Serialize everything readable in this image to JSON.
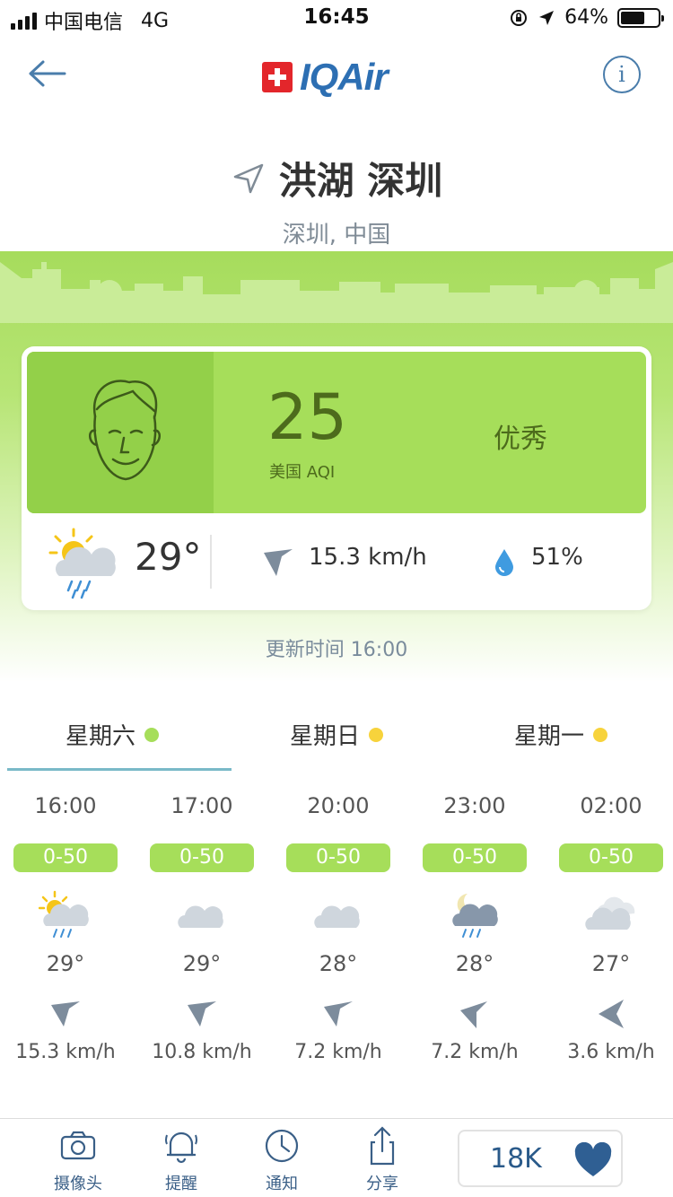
{
  "status_bar": {
    "carrier": "中国电信",
    "network": "4G",
    "time": "16:45",
    "battery": "64%",
    "battery_level": 0.64
  },
  "header": {
    "brand": "IQAir",
    "info_label": "i"
  },
  "location": {
    "name": "洪湖 深圳",
    "region": "深圳, 中国"
  },
  "aqi": {
    "value": "25",
    "label": "美国 AQI",
    "level": "优秀",
    "color": "#a6de5a"
  },
  "current_weather": {
    "temperature": "29°",
    "wind_speed": "15.3 km/h",
    "humidity": "51%",
    "icon": "sun-cloud-rain-icon"
  },
  "updated": "更新时间 16:00",
  "days": [
    {
      "label": "星期六",
      "dot_color": "#a6de5a",
      "active": true
    },
    {
      "label": "星期日",
      "dot_color": "#f7d33c",
      "active": false
    },
    {
      "label": "星期一",
      "dot_color": "#f7d33c",
      "active": false
    }
  ],
  "hourly": [
    {
      "time": "16:00",
      "aqi_range": "0-50",
      "icon": "sun-cloud-rain-icon",
      "temp": "29°",
      "wind": "15.3 km/h"
    },
    {
      "time": "17:00",
      "aqi_range": "0-50",
      "icon": "cloud-icon",
      "temp": "29°",
      "wind": "10.8 km/h"
    },
    {
      "time": "20:00",
      "aqi_range": "0-50",
      "icon": "cloud-icon",
      "temp": "28°",
      "wind": "7.2 km/h"
    },
    {
      "time": "23:00",
      "aqi_range": "0-50",
      "icon": "moon-cloud-rain-icon",
      "temp": "28°",
      "wind": "7.2 km/h"
    },
    {
      "time": "02:00",
      "aqi_range": "0-50",
      "icon": "clouds-icon",
      "temp": "27°",
      "wind": "3.6 km/h"
    }
  ],
  "bottom_nav": {
    "camera": "摄像头",
    "alerts": "提醒",
    "notifications": "通知",
    "share": "分享",
    "likes": "18K"
  }
}
